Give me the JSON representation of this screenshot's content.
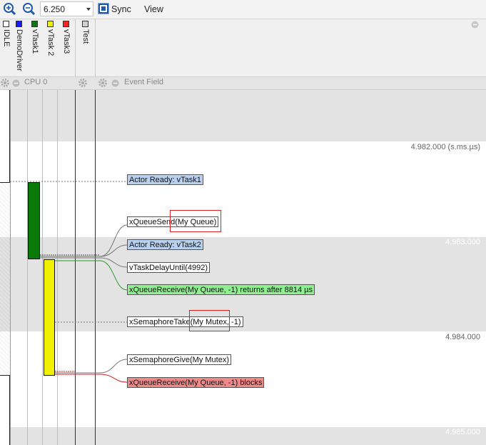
{
  "toolbar": {
    "zoom_in_icon": "zoom-in-icon",
    "zoom_out_icon": "zoom-out-icon",
    "zoom_value": "6.250",
    "sync_label": "Sync",
    "view_label": "View"
  },
  "header": {
    "columns": [
      {
        "label": "IDLE",
        "color": "#ffffff"
      },
      {
        "label": "DemoDriver",
        "color": "#1a1aff"
      },
      {
        "label": "vTask1",
        "color": "#0a7a0a"
      },
      {
        "label": "vTask 2",
        "color": "#f0f000"
      },
      {
        "label": "vTask3",
        "color": "#ff2020"
      },
      {
        "label": "Test",
        "color": "#d0d0d0"
      }
    ]
  },
  "section": {
    "cpu_label": "CPU 0",
    "event_field_label": "Event Field"
  },
  "timestamps": {
    "t1": "4.982.000 (s.ms.µs)",
    "t2": "4.983.000",
    "t3": "4.984.000",
    "t4": "4.985.000"
  },
  "events": {
    "e1": "Actor Ready: vTask1",
    "e2": "xQueueSend(My Queue)",
    "e3": "Actor Ready: vTask2",
    "e4": "vTaskDelayUntil(4992)",
    "e5": "xQueueReceive(My Queue, -1) returns after 8814 µs",
    "e6": "xSemaphoreTake(My Mutex, -1)",
    "e7": "xSemaphoreGive(My Mutex)",
    "e8": "xQueueReceive(My Queue, -1) blocks"
  },
  "colors": {
    "vtask1": "#0a7a0a",
    "vtask2": "#f0f000",
    "band": "#e3e3e3",
    "highlight": "#e02020"
  }
}
